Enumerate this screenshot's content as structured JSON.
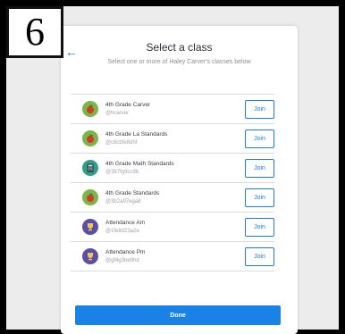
{
  "step": {
    "number": "6"
  },
  "dialog": {
    "back_arrow": "←",
    "title": "Select a class",
    "subtitle": "Select one or more of Haley Carver's classes below"
  },
  "classes": [
    {
      "name": "4th Grade Carver",
      "code": "@hcarver",
      "icon": "apple-icon",
      "join_label": "Join"
    },
    {
      "name": "4th Grade La Standards",
      "code": "@c8cbfe8dhf",
      "icon": "apple-icon",
      "join_label": "Join"
    },
    {
      "name": "4th Grade Math Standards",
      "code": "@387fg9cc9b",
      "icon": "calculator-icon",
      "join_label": "Join"
    },
    {
      "name": "4th Grade Standards",
      "code": "@3b2a97ega8",
      "icon": "apple-icon",
      "join_label": "Join"
    },
    {
      "name": "Attendance Am",
      "code": "@1fe8d23a2e",
      "icon": "trophy-icon",
      "join_label": "Join"
    },
    {
      "name": "Attendance Pm",
      "code": "@gf4g3be9hd",
      "icon": "trophy-icon",
      "join_label": "Join"
    }
  ],
  "done_label": "Done",
  "colors": {
    "accent": "#1f7ae0",
    "done_button": "#1a82e6",
    "apple_avatar_bg": "#7ab648",
    "calculator_avatar_bg": "#2f9e8b",
    "trophy_avatar_bg": "#5a4fa8"
  }
}
